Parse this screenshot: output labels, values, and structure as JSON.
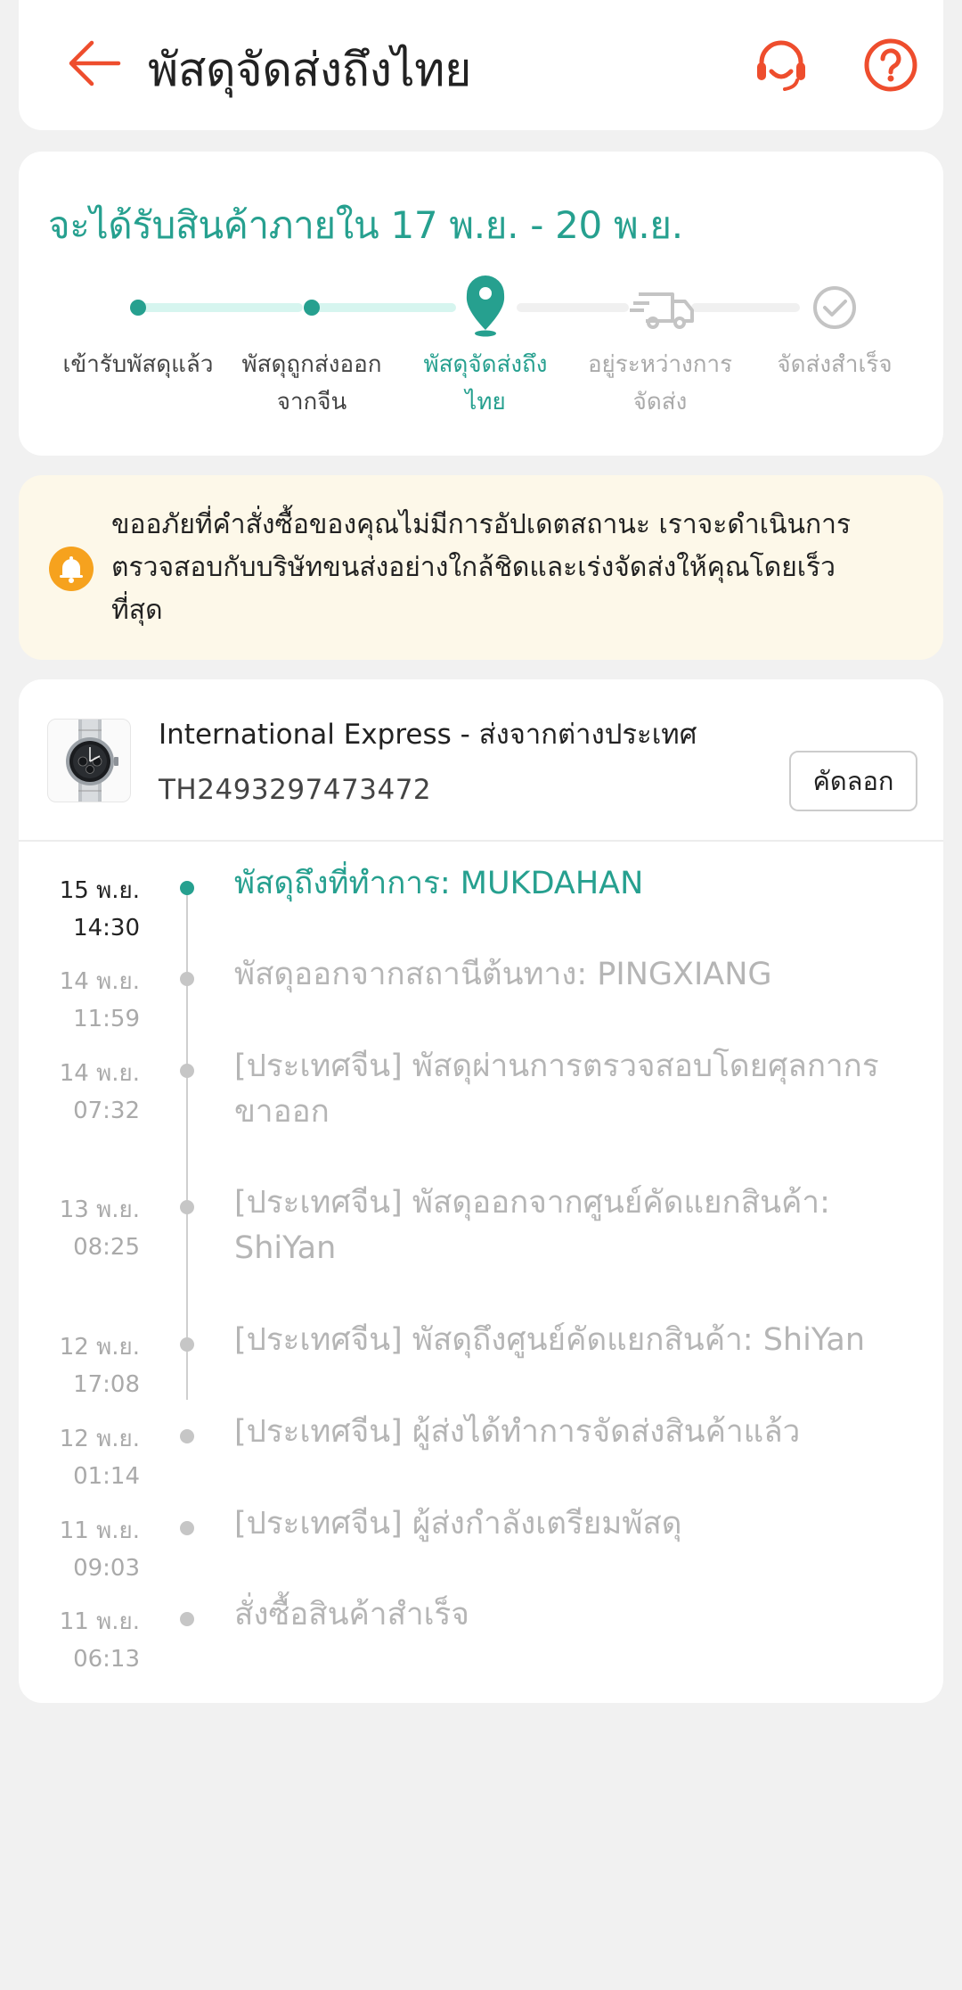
{
  "header": {
    "title": "พัสดุจัดส่งถึงไทย",
    "back_icon": "arrow-left-icon",
    "support_icon": "headset-icon",
    "help_icon": "question-circle-icon",
    "accent_color": "#ee4d2d"
  },
  "progress": {
    "eta": "จะได้รับสินค้าภายใน 17 พ.ย. - 20 พ.ย.",
    "accent_color": "#26a08f",
    "steps": [
      {
        "line1": "เข้ารับพัสดุแล้ว",
        "line2": "",
        "state": "done"
      },
      {
        "line1": "พัสดุถูกส่งออก",
        "line2": "จากจีน",
        "state": "done"
      },
      {
        "line1": "พัสดุจัดส่งถึง",
        "line2": "ไทย",
        "state": "current"
      },
      {
        "line1": "อยู่ระหว่างการ",
        "line2": "จัดส่ง",
        "state": "pending"
      },
      {
        "line1": "จัดส่งสำเร็จ",
        "line2": "",
        "state": "pending"
      }
    ]
  },
  "notice": {
    "icon": "bell-icon",
    "lines": [
      "ขออภัยที่คำสั่งซื้อของคุณไม่มีการอัปเดตสถานะ เราจะดำเนินการ",
      "ตรวจสอบกับบริษัทขนส่งอย่างใกล้ชิดและเร่งจัดส่งให้คุณโดยเร็ว",
      "ที่สุด"
    ]
  },
  "shipment": {
    "courier": "International Express - ส่งจากต่างประเทศ",
    "tracking_number": "TH2493297473472",
    "copy_label": "คัดลอก",
    "events": [
      {
        "date": "15 พ.ย.",
        "time": "14:30",
        "lines": [
          "พัสดุถึงที่ทำการ: MUKDAHAN"
        ]
      },
      {
        "date": "14 พ.ย.",
        "time": "11:59",
        "lines": [
          "พัสดุออกจากสถานีต้นทาง: PINGXIANG"
        ]
      },
      {
        "date": "14 พ.ย.",
        "time": "07:32",
        "lines": [
          "[ประเทศจีน] พัสดุผ่านการตรวจสอบโดยศุลกากร",
          "ขาออก"
        ]
      },
      {
        "date": "13 พ.ย.",
        "time": "08:25",
        "lines": [
          "[ประเทศจีน] พัสดุออกจากศูนย์คัดแยกสินค้า:",
          "ShiYan"
        ]
      },
      {
        "date": "12 พ.ย.",
        "time": "17:08",
        "lines": [
          "[ประเทศจีน] พัสดุถึงศูนย์คัดแยกสินค้า: ShiYan"
        ]
      },
      {
        "date": "12 พ.ย.",
        "time": "01:14",
        "lines": [
          "[ประเทศจีน] ผู้ส่งได้ทำการจัดส่งสินค้าแล้ว"
        ]
      },
      {
        "date": "11 พ.ย.",
        "time": "09:03",
        "lines": [
          "[ประเทศจีน] ผู้ส่งกำลังเตรียมพัสดุ"
        ]
      },
      {
        "date": "11 พ.ย.",
        "time": "06:13",
        "lines": [
          "สั่งซื้อสินค้าสำเร็จ"
        ]
      }
    ]
  }
}
